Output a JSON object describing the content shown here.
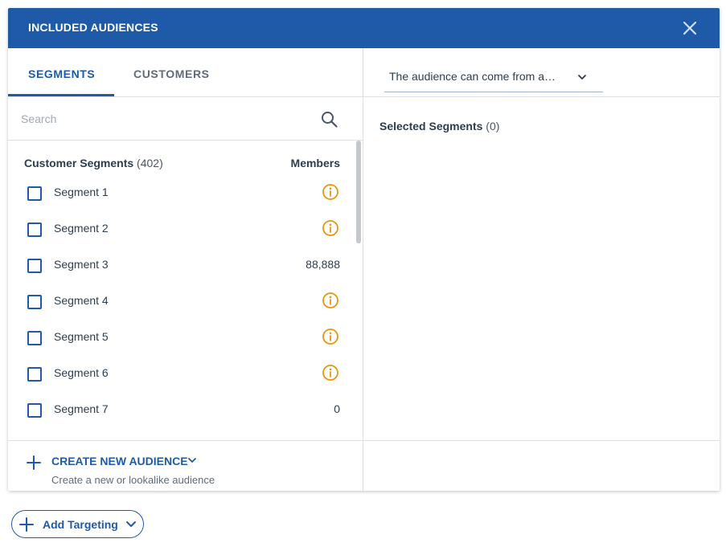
{
  "header": {
    "title": "INCLUDED AUDIENCES",
    "close_icon": "close-icon"
  },
  "tabs": [
    {
      "label": "SEGMENTS",
      "active": true
    },
    {
      "label": "CUSTOMERS",
      "active": false
    }
  ],
  "search": {
    "placeholder": "Search",
    "value": "",
    "icon": "search-icon"
  },
  "list": {
    "title": "Customer Segments",
    "count": "(402)",
    "members_header": "Members",
    "rows": [
      {
        "label": "Segment 1",
        "value": "",
        "info": true,
        "checked": false
      },
      {
        "label": "Segment 2",
        "value": "",
        "info": true,
        "checked": false
      },
      {
        "label": "Segment 3",
        "value": "88,888",
        "info": false,
        "checked": false
      },
      {
        "label": "Segment 4",
        "value": "",
        "info": true,
        "checked": false
      },
      {
        "label": "Segment 5",
        "value": "",
        "info": true,
        "checked": false
      },
      {
        "label": "Segment 6",
        "value": "",
        "info": true,
        "checked": false
      },
      {
        "label": "Segment 7",
        "value": "0",
        "info": false,
        "checked": false
      }
    ]
  },
  "create": {
    "label": "CREATE NEW AUDIENCE",
    "subtitle": "Create a new or lookalike audience"
  },
  "right": {
    "dropdown_value": "The audience can come from a…",
    "selected_title": "Selected Segments",
    "selected_count": "(0)"
  },
  "add_targeting": {
    "label": "Add Targeting"
  },
  "colors": {
    "accent": "#1f5aa8",
    "info": "#e8950f",
    "divider": "#dcdfe4"
  }
}
